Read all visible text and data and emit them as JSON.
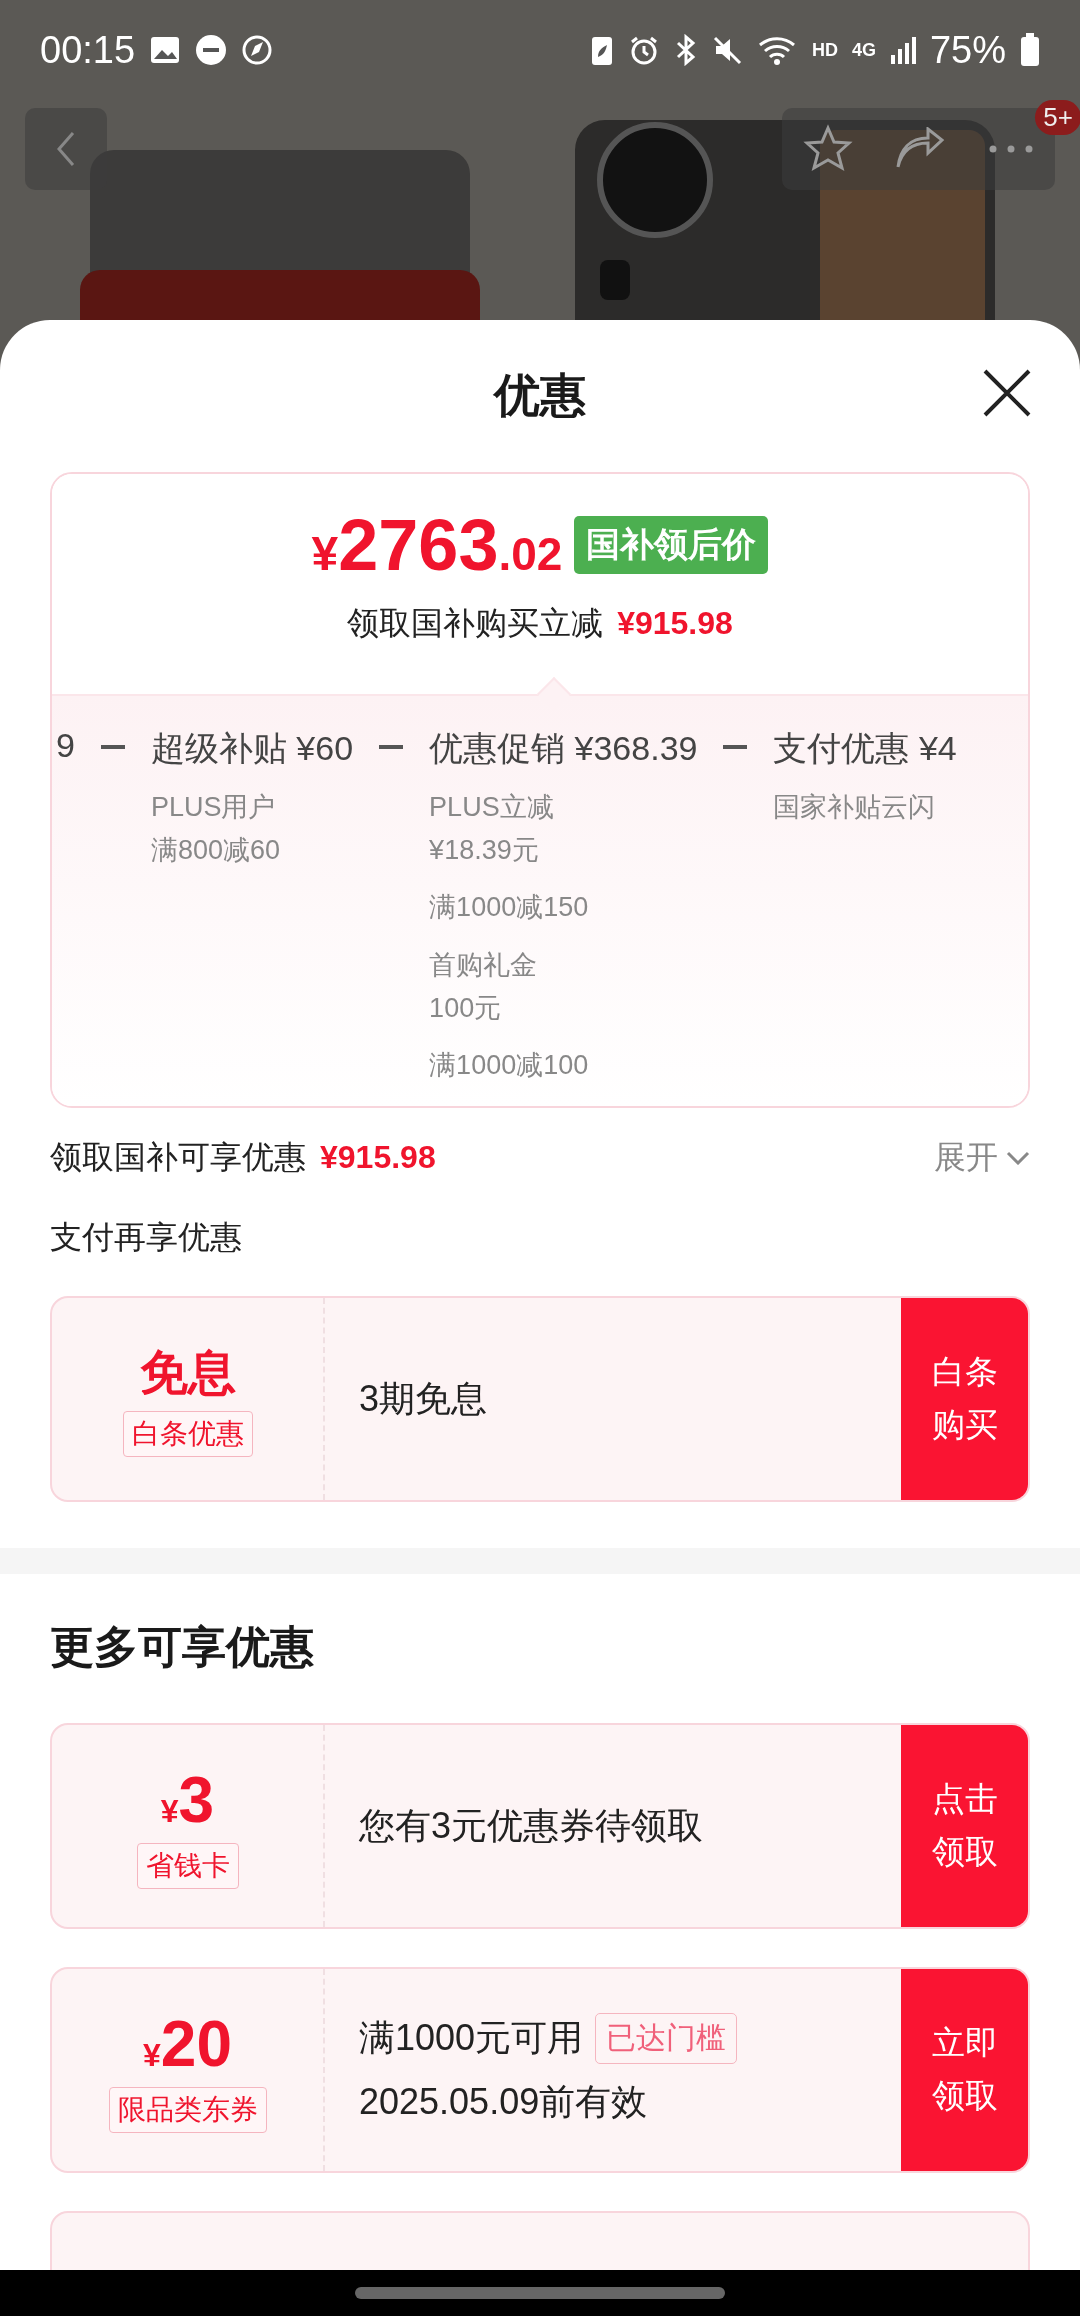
{
  "status_bar": {
    "time": "00:15",
    "network_hd": "HD",
    "network_type": "4G",
    "battery": "75%"
  },
  "top_nav": {
    "badge": "5+"
  },
  "sheet": {
    "title": "优惠"
  },
  "price_card": {
    "currency": "¥",
    "price_int": "2763",
    "price_dec": ".02",
    "tag": "国补领后价",
    "subtitle": "领取国补购买立减",
    "subtitle_amount": "¥915.98",
    "breakdown": [
      {
        "title": "9"
      },
      {
        "title": "超级补贴 ¥60",
        "notes": [
          [
            "PLUS用户",
            "满800减60"
          ]
        ]
      },
      {
        "title": "优惠促销 ¥368.39",
        "notes": [
          [
            "PLUS立减",
            "¥18.39元"
          ],
          [
            "满1000减150"
          ],
          [
            "首购礼金",
            "100元"
          ],
          [
            "满1000减100"
          ]
        ]
      },
      {
        "title": "支付优惠 ¥4",
        "notes": [
          [
            "国家补贴云闪"
          ]
        ]
      }
    ]
  },
  "summary": {
    "label": "领取国补可享优惠",
    "amount": "¥915.98",
    "toggle": "展开"
  },
  "pay_section": {
    "title": "支付再享优惠",
    "coupons": [
      {
        "kind": "text",
        "headline": "免息",
        "tag": "白条优惠",
        "lines": [
          "3期免息"
        ],
        "button": "白条购买"
      }
    ]
  },
  "more_section": {
    "title": "更多可享优惠",
    "coupons": [
      {
        "kind": "amount",
        "currency": "¥",
        "headline": "3",
        "tag": "省钱卡",
        "lines": [
          "您有3元优惠券待领取"
        ],
        "button": "点击领取"
      },
      {
        "kind": "amount",
        "currency": "¥",
        "headline": "20",
        "tag": "限品类东券",
        "lines": [
          "满1000元可用",
          "2025.05.09前有效"
        ],
        "badge": "已达门槛",
        "button": "立即领取"
      }
    ]
  }
}
